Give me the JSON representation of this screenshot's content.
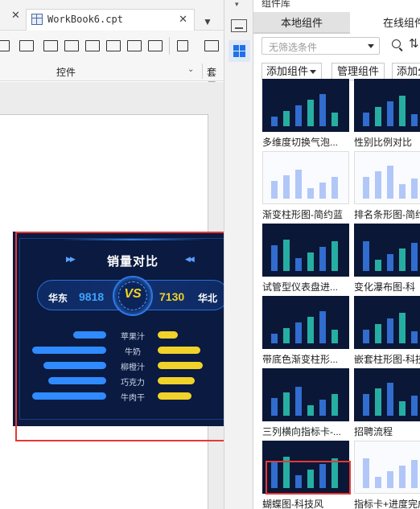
{
  "workbook": {
    "tab_title": "WorkBook6.cpt",
    "group_label": "控件",
    "group_label2": "套用"
  },
  "widget": {
    "title": "销量对比",
    "left_region": "华东",
    "left_value": "9818",
    "vs_text": "VS",
    "right_value": "7130",
    "right_region": "华北",
    "colors": {
      "left": "#2f8bff",
      "right": "#f0d22a",
      "background": "#0a1a40"
    },
    "rows": [
      {
        "category": "苹果汁",
        "left": 0.45,
        "right": 0.35
      },
      {
        "category": "牛奶",
        "left": 1.0,
        "right": 0.75
      },
      {
        "category": "柳橙汁",
        "left": 0.85,
        "right": 0.8
      },
      {
        "category": "巧克力",
        "left": 0.78,
        "right": 0.65
      },
      {
        "category": "牛肉干",
        "left": 1.0,
        "right": 0.6
      }
    ]
  },
  "library": {
    "panel_title": "组件库",
    "tab_local": "本地组件",
    "tab_online": "在线组件",
    "filter_placeholder": "无筛选条件",
    "add_button": "添加组件",
    "manage_button": "管理组件",
    "add_partial_button": "添加分",
    "cards": [
      {
        "label": "多维度切换气泡...",
        "theme": "dark"
      },
      {
        "label": "性别比例对比",
        "theme": "dark"
      },
      {
        "label": "渐变柱形图-简约蓝",
        "theme": "light"
      },
      {
        "label": "排名条形图-简约",
        "theme": "light"
      },
      {
        "label": "试管型仪表盘进...",
        "theme": "dark"
      },
      {
        "label": "变化瀑布图-科",
        "theme": "dark"
      },
      {
        "label": "带底色渐变柱形...",
        "theme": "dark"
      },
      {
        "label": "嵌套柱形图-科技",
        "theme": "dark"
      },
      {
        "label": "三列横向指标卡-...",
        "theme": "dark"
      },
      {
        "label": "招聘流程",
        "theme": "dark"
      },
      {
        "label": "蝴蝶图-科技风",
        "theme": "dark"
      },
      {
        "label": "指标卡+进度完成",
        "theme": "light"
      }
    ]
  }
}
